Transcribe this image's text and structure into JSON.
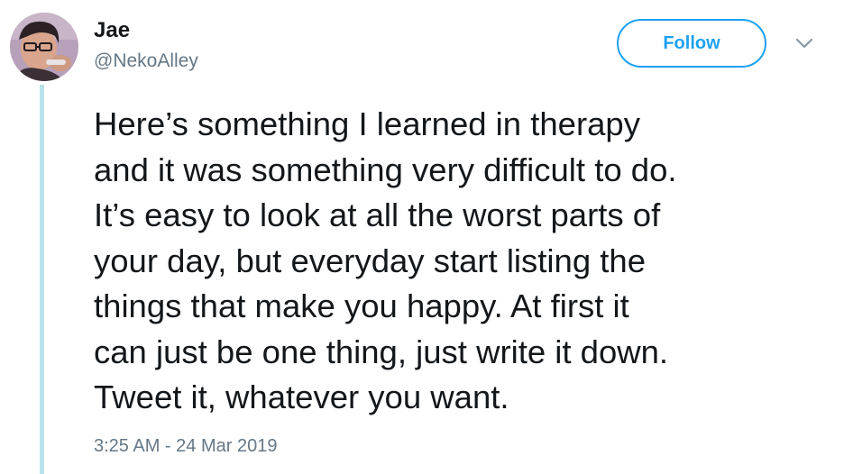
{
  "author": {
    "display_name": "Jae",
    "handle": "@NekoAlley"
  },
  "actions": {
    "follow_label": "Follow",
    "more_icon": "chevron-down-icon"
  },
  "tweet": {
    "lines": [
      "Here’s something I learned in therapy",
      "and it was something very difficult to do.",
      "It’s easy to look at all the worst parts of",
      "your day, but everyday start listing the",
      "things that make you happy. At first it",
      "can just be one thing, just write it down.",
      "Tweet it, whatever you want."
    ],
    "timestamp": "3:25 AM - 24 Mar 2019"
  },
  "colors": {
    "accent": "#1da1f2",
    "thread_line": "#b9e1ec",
    "text": "#14171a",
    "secondary_text": "#657786"
  }
}
